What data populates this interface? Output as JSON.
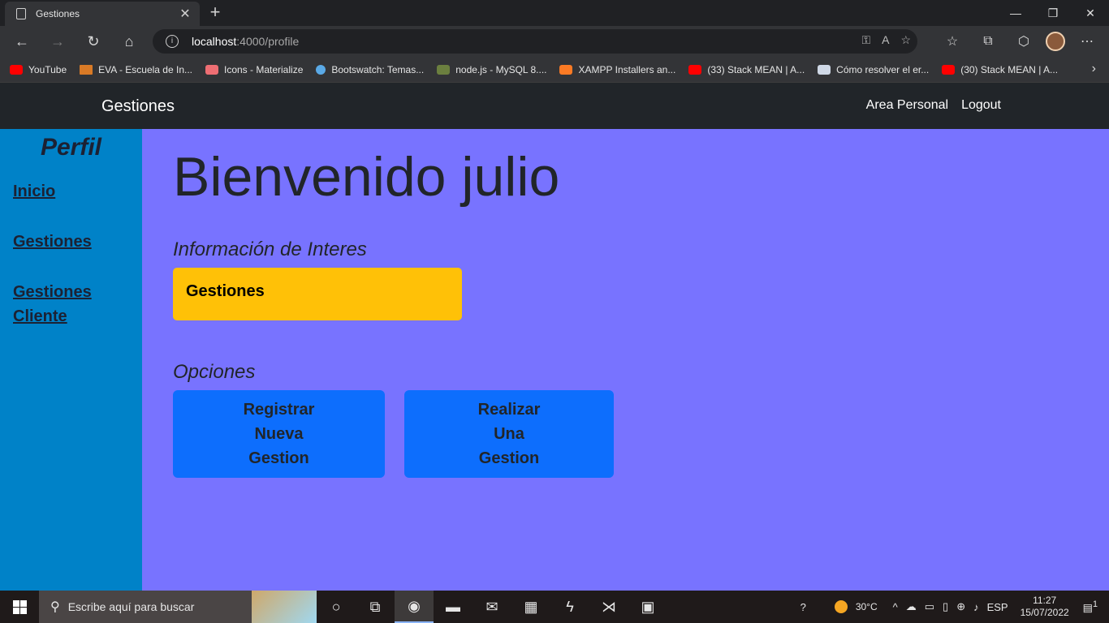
{
  "browser": {
    "tab_title": "Gestiones",
    "url_host": "localhost",
    "url_path": ":4000/profile",
    "bookmarks": [
      {
        "label": "YouTube",
        "icon": "youtube-icon"
      },
      {
        "label": "EVA - Escuela de In...",
        "icon": "eva-icon"
      },
      {
        "label": "Icons - Materialize",
        "icon": "materialize-icon"
      },
      {
        "label": "Bootswatch: Temas...",
        "icon": "bootswatch-icon"
      },
      {
        "label": "node.js - MySQL 8....",
        "icon": "stackoverflow-icon"
      },
      {
        "label": "XAMPP Installers an...",
        "icon": "xampp-icon"
      },
      {
        "label": "(33) Stack MEAN | A...",
        "icon": "youtube-icon"
      },
      {
        "label": "Cómo resolver el er...",
        "icon": "site-icon"
      },
      {
        "label": "(30) Stack MEAN | A...",
        "icon": "youtube-icon"
      }
    ]
  },
  "navbar": {
    "brand": "Gestiones",
    "links": [
      "Area Personal",
      "Logout"
    ]
  },
  "sidebar": {
    "title": "Perfil",
    "items": [
      "Inicio",
      "Gestiones",
      "Gestiones",
      "Cliente"
    ]
  },
  "main": {
    "welcome": "Bienvenido julio",
    "info_label": "Información de Interes",
    "info_card": "Gestiones",
    "options_label": "Opciones",
    "options": [
      {
        "lines": [
          "Registrar",
          "Nueva",
          "Gestion"
        ]
      },
      {
        "lines": [
          "Realizar",
          "Una",
          "Gestion"
        ]
      }
    ]
  },
  "taskbar": {
    "search_placeholder": "Escribe aquí para buscar",
    "temperature": "30°C",
    "language": "ESP",
    "time": "11:27",
    "date": "15/07/2022",
    "notifications": "1"
  },
  "colors": {
    "page_bg": "#7873ff",
    "navbar_bg": "#212529",
    "sidebar_bg": "#0082c8",
    "card_bg": "#ffc107",
    "button_bg": "#0d6efd"
  }
}
